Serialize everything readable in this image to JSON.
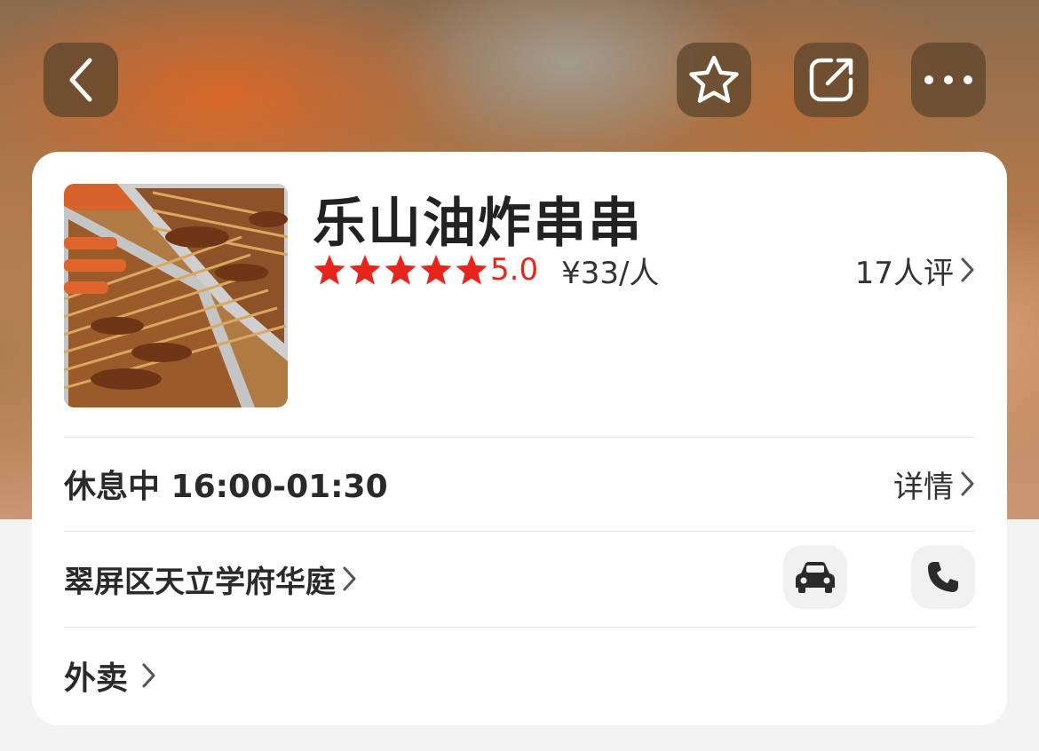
{
  "restaurant": {
    "name": "乐山油炸串串",
    "rating_stars": 5,
    "score": "5.0",
    "price": "¥33/人",
    "reviews": "17人评"
  },
  "hours": {
    "text": "休息中 16:00-01:30",
    "detail_label": "详情"
  },
  "address": {
    "text": "翠屏区天立学府华庭"
  },
  "takeout": {
    "label": "外卖"
  },
  "icons": {
    "back": "back-icon",
    "favorite": "star-outline-icon",
    "share": "share-icon",
    "more": "more-icon",
    "car": "car-icon",
    "phone": "phone-icon"
  },
  "colors": {
    "accent_red": "#e8241c"
  }
}
